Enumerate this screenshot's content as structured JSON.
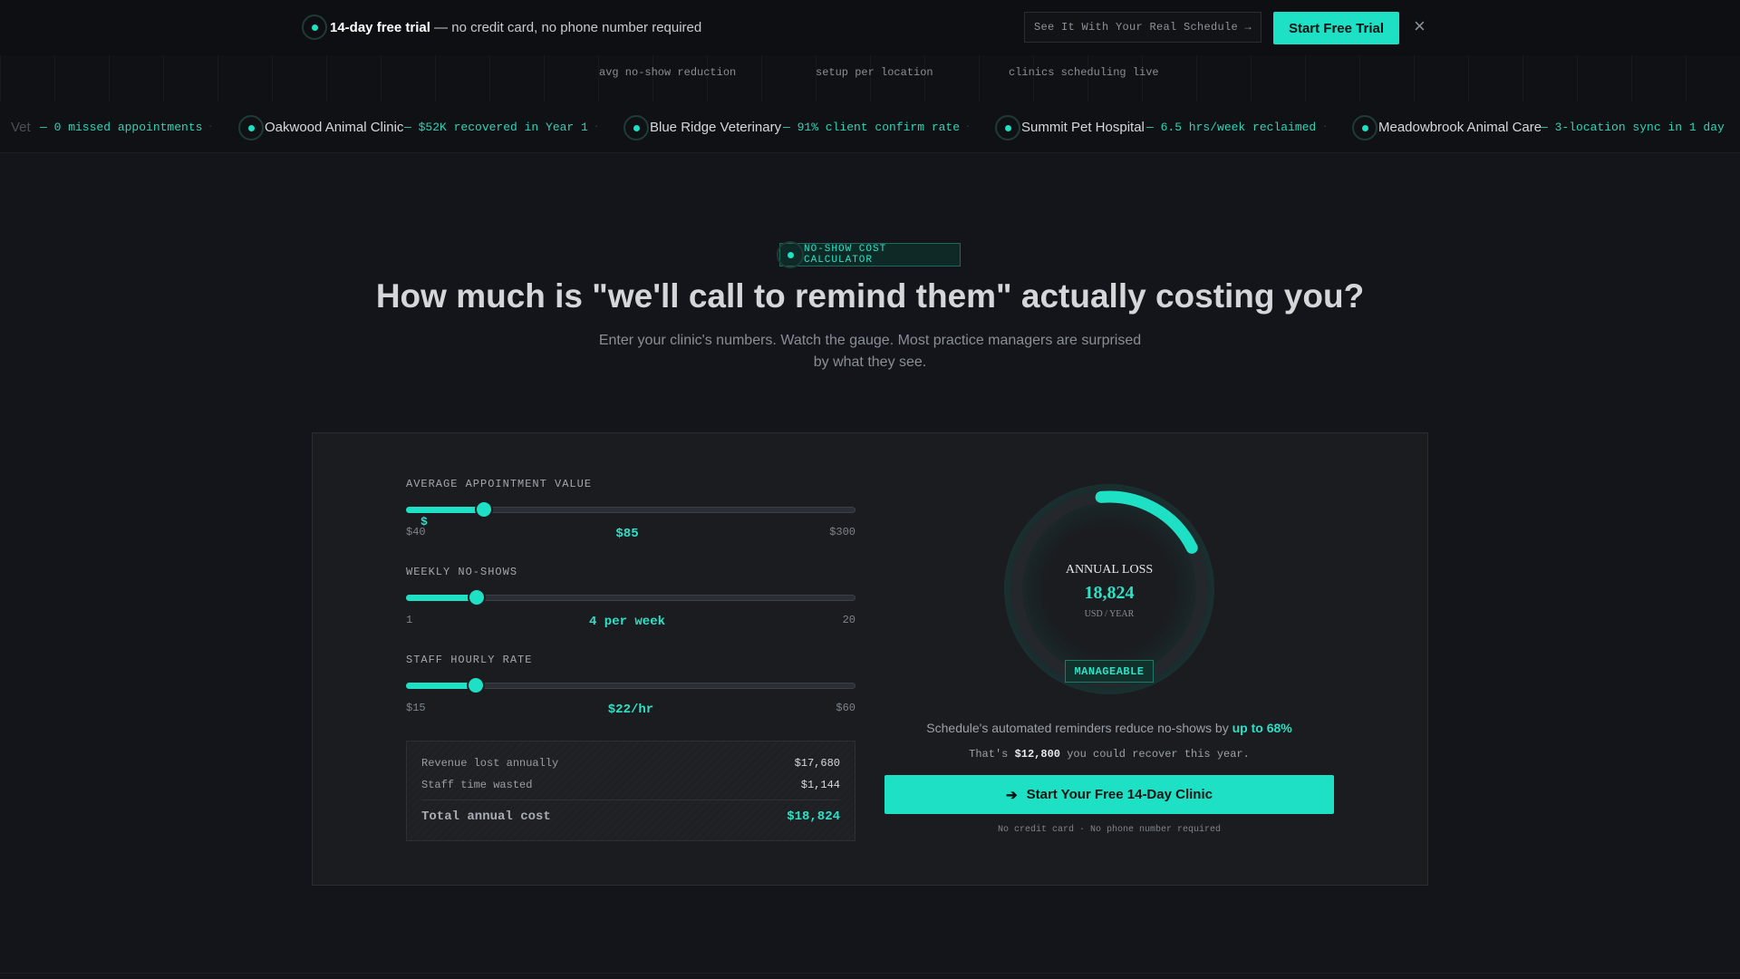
{
  "topbar": {
    "trial_bold": "14-day free trial",
    "trial_rest": " — no credit card, no phone number required",
    "see_button": "See It With Your Real Schedule →",
    "start_button": "Start Free Trial",
    "close_symbol": "×"
  },
  "stats": {
    "labels": [
      "avg no-show reduction",
      "setup per location",
      "clinics scheduling live"
    ]
  },
  "ticker": {
    "lead_name": "Vet",
    "lead_stat": "— 0 missed appointments",
    "items": [
      {
        "name": "Oakwood Animal Clinic",
        "stat": "— $52K recovered in Year 1"
      },
      {
        "name": "Blue Ridge Veterinary",
        "stat": "— 91% client confirm rate"
      },
      {
        "name": "Summit Pet Hospital",
        "stat": "— 6.5 hrs/week reclaimed"
      },
      {
        "name": "Meadowbrook Animal Care",
        "stat": "— 3-location sync in 1 day"
      }
    ],
    "separator": "·"
  },
  "hero": {
    "badge": "NO-SHOW COST CALCULATOR",
    "title": "How much is \"we'll call to remind them\" actually costing you?",
    "subtitle": "Enter your clinic's numbers. Watch the gauge. Most practice managers are surprised by what they see."
  },
  "calculator": {
    "appointment": {
      "label": "AVERAGE APPOINTMENT VALUE",
      "prefix": "$",
      "min_label": "$40",
      "max_label": "$300",
      "value_label": "$85",
      "min": 40,
      "max": 300,
      "value": 85
    },
    "noshows": {
      "label": "WEEKLY NO-SHOWS",
      "min_label": "1",
      "max_label": "20",
      "value_label": "4 per week",
      "min": 1,
      "max": 20,
      "value": 4
    },
    "rate": {
      "label": "STAFF HOURLY RATE",
      "min_label": "$15",
      "max_label": "$60",
      "value_label": "$22/hr",
      "min": 15,
      "max": 60,
      "value": 22
    },
    "summary": {
      "revenue_label": "Revenue lost annually",
      "revenue_value": "$17,680",
      "staff_label": "Staff time wasted",
      "staff_value": "$1,144",
      "total_label": "Total annual cost",
      "total_value": "$18,824"
    }
  },
  "gauge": {
    "title": "ANNUAL LOSS",
    "value": "18,824",
    "unit": "USD / YEAR",
    "status": "MANAGEABLE",
    "fraction": 0.19
  },
  "result": {
    "reduce_prefix": "Schedule's automated reminders reduce no-shows by ",
    "reduce_bold": "up to 68%",
    "recover_prefix": "That's ",
    "recover_bold": "$12,800",
    "recover_suffix": " you could recover this year.",
    "cta": "Start Your Free 14-Day Clinic",
    "fine_print": "No credit card · No phone number required"
  },
  "colors": {
    "accent": "#1de0c4",
    "background": "#13151a",
    "panel": "#1a1c20"
  }
}
